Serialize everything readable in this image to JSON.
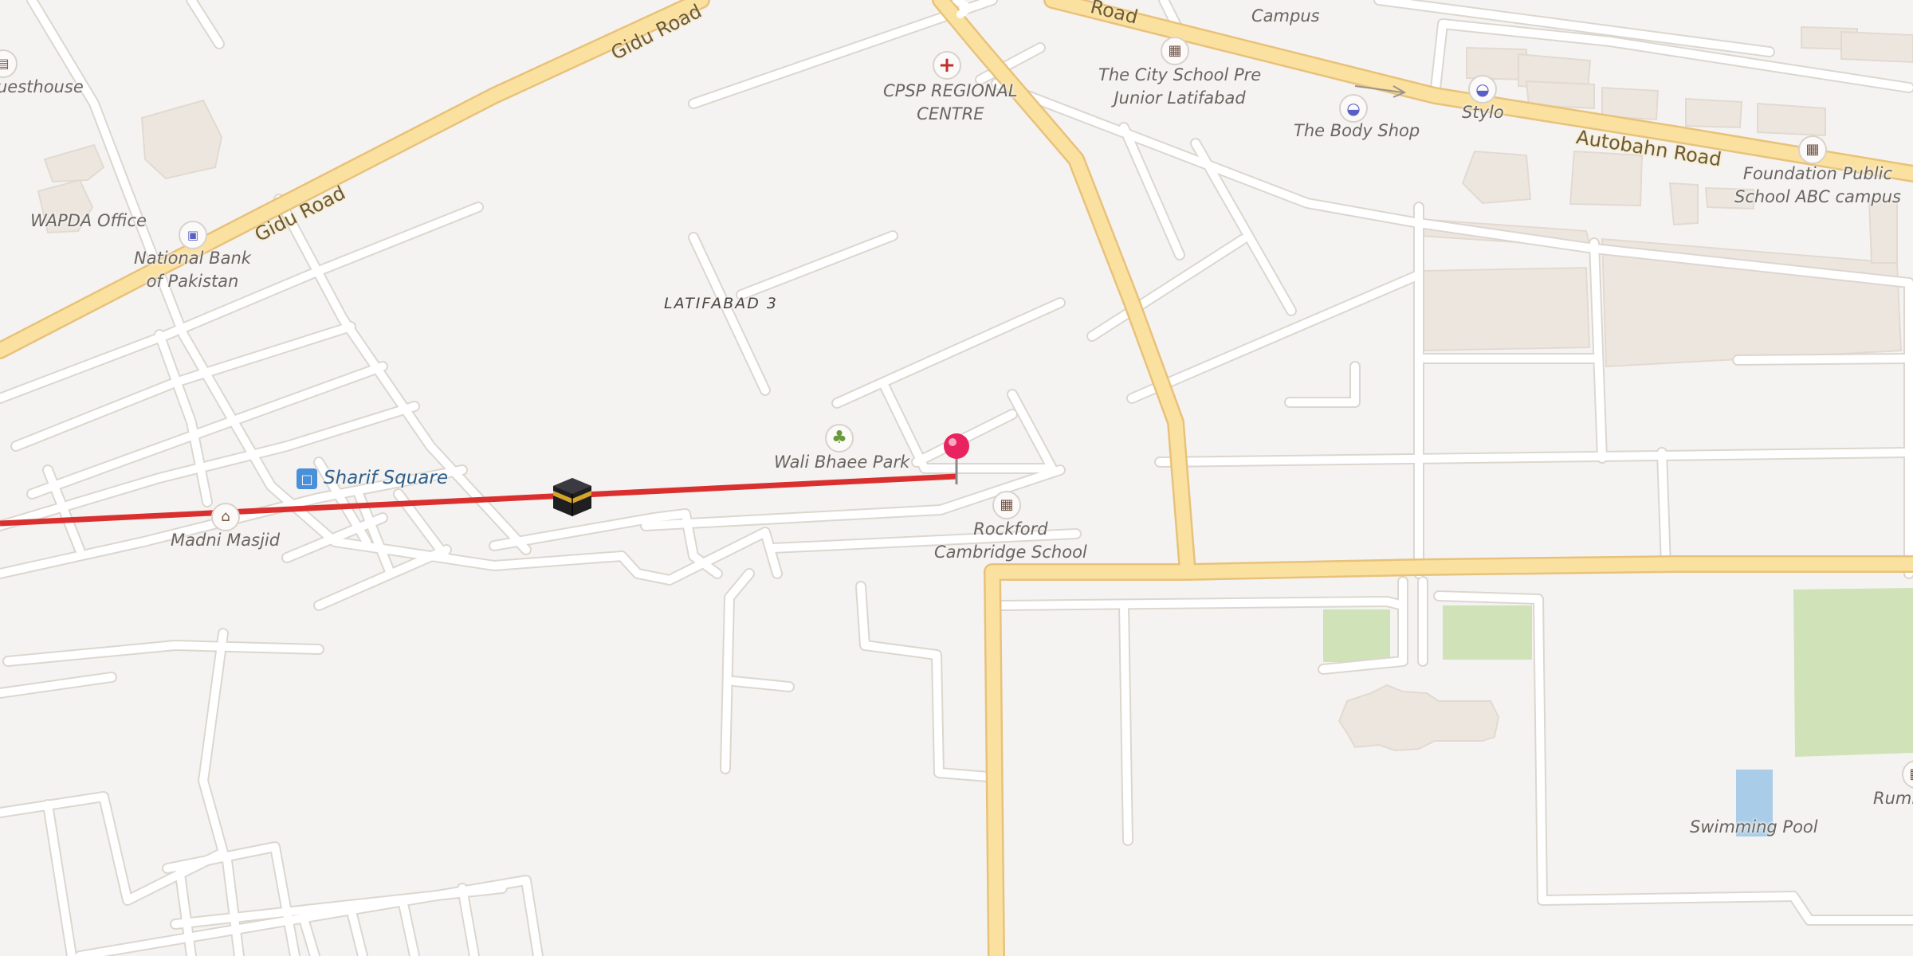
{
  "map": {
    "roads": {
      "gidu_upper": "Gidu Road",
      "gidu_lower": "Gidu Road",
      "road_top": "Road",
      "autobahn": "Autobahn Road"
    },
    "area_label": "LATIFABAD 3",
    "places": {
      "guesthouse": "uesthouse",
      "wapda": "WAPDA Office",
      "nbp": "National Bank\nof Pakistan",
      "cpsp": "CPSP REGIONAL\nCENTRE",
      "city_school": "The City School Pre\nJunior Latifabad",
      "campus": "Campus",
      "body_shop": "The Body Shop",
      "stylo": "Stylo",
      "foundation": "Foundation Public\nSchool ABC campus",
      "wali_park": "Wali Bhaee Park",
      "rockford": "Rockford\nCambridge School",
      "sharif_square": "Sharif Square",
      "madni_masjid": "Madni Masjid",
      "swimming_pool": "Swimming Pool",
      "rumi": "Rumi"
    },
    "icons": {
      "guesthouse": "bed-icon",
      "bank": "banknote-icon",
      "hospital": "medical-cross-icon",
      "school": "school-icon",
      "shop": "shopping-basket-icon",
      "park": "tree-icon",
      "bus": "bus-stop-icon",
      "mosque": "mosque-icon",
      "kaaba": "kaaba-icon",
      "pin": "location-pin-icon"
    },
    "colors": {
      "background": "#f5f3f1",
      "street": "#ffffff",
      "major_road": "#fbe1a0",
      "major_road_edge": "#e8c27a",
      "qibla_line": "#d9302f",
      "pin": "#e8235f",
      "park_fill": "#cfe2b8",
      "water": "#a9cde8"
    }
  }
}
